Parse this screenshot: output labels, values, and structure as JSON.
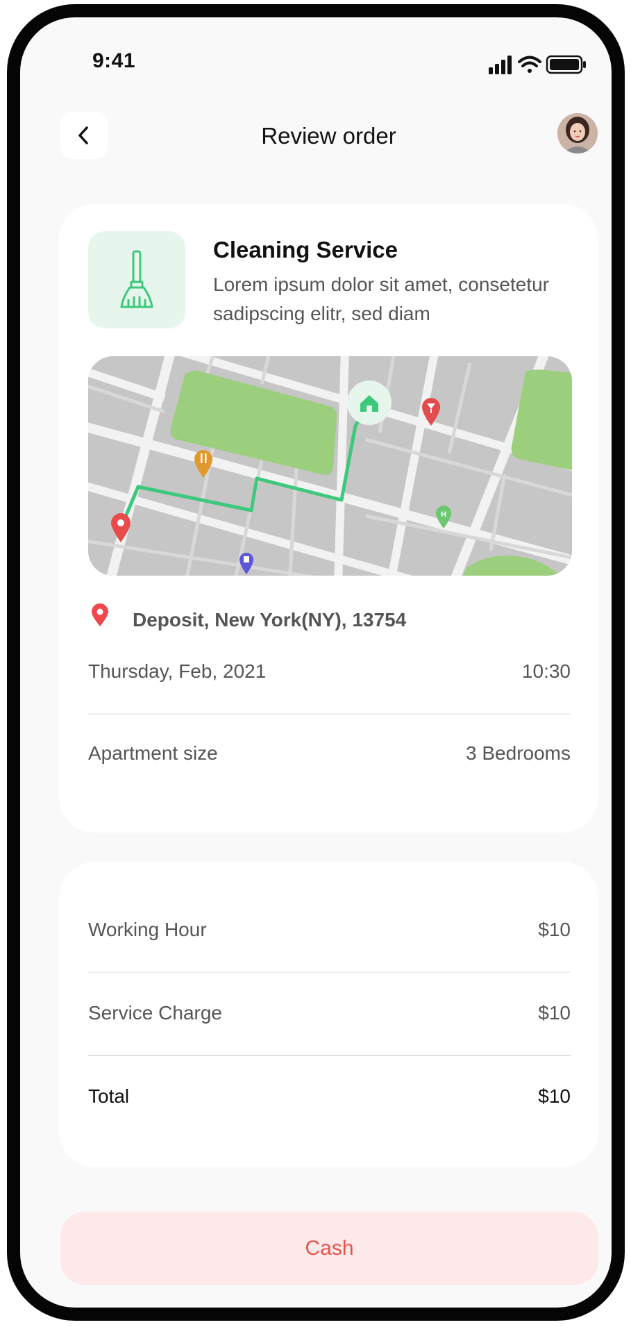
{
  "status_bar": {
    "time": "9:41",
    "icons": [
      "signal-icon",
      "wifi-icon",
      "battery-icon"
    ]
  },
  "header": {
    "title": "Review order",
    "back_icon": "chevron-left-icon",
    "avatar": "user-avatar"
  },
  "service": {
    "icon": "broom-icon",
    "title": "Cleaning Service",
    "description": "Lorem ipsum dolor sit amet, consetetur sadipscing elitr, sed diam"
  },
  "map": {
    "pins": [
      "start-pin-icon",
      "home-pin-icon",
      "restaurant-pin-icon",
      "bar-pin-icon",
      "hospital-pin-icon",
      "fuel-pin-icon"
    ]
  },
  "location": {
    "icon": "location-pin-icon",
    "address": "Deposit, New York(NY), 13754"
  },
  "schedule": {
    "date": "Thursday, Feb, 2021",
    "time": "10:30"
  },
  "apartment": {
    "label": "Apartment size",
    "value": "3 Bedrooms"
  },
  "charges": {
    "working_hour": {
      "label": "Working Hour",
      "value": "$10"
    },
    "service_charge": {
      "label": "Service Charge",
      "value": "$10"
    },
    "total": {
      "label": "Total",
      "value": "$10"
    }
  },
  "payment": {
    "cash_label": "Cash"
  },
  "colors": {
    "accent_green": "#3dc87c",
    "accent_red": "#e5534f",
    "cash_bg": "#fde9e9"
  }
}
